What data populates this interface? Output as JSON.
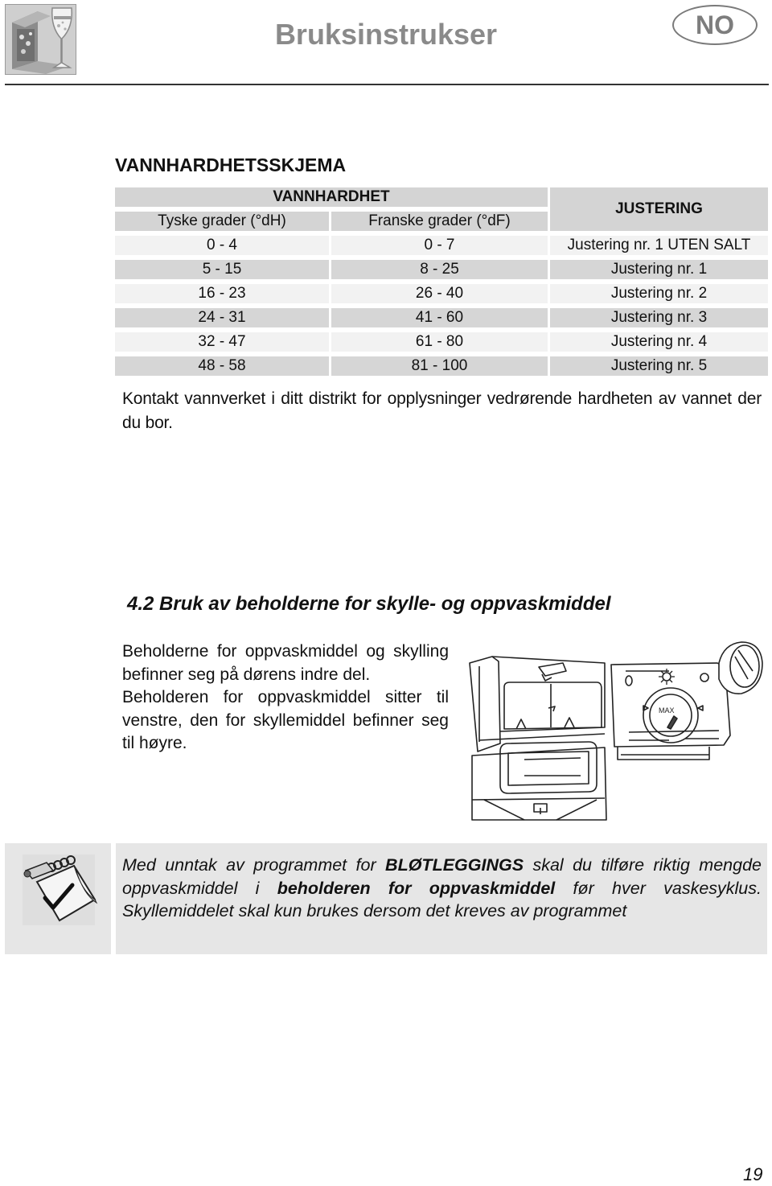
{
  "header": {
    "logo_icon": "dishwasher-wine-glass-logo",
    "title": "Bruksinstrukser",
    "language_badge": "NO"
  },
  "hardness_section": {
    "title": "VANNHARDHETSSKJEMA",
    "table": {
      "group_header": "VANNHARDHET",
      "columns": [
        "Tyske grader (°dH)",
        "Franske grader (°dF)",
        "JUSTERING"
      ],
      "rows": [
        {
          "dh": "0 - 4",
          "df": "0 - 7",
          "setting": "Justering nr. 1 UTEN SALT"
        },
        {
          "dh": "5 - 15",
          "df": "8 - 25",
          "setting": "Justering nr. 1"
        },
        {
          "dh": "16 - 23",
          "df": "26 - 40",
          "setting": "Justering nr. 2"
        },
        {
          "dh": "24 - 31",
          "df": "41 - 60",
          "setting": "Justering nr. 3"
        },
        {
          "dh": "32 - 47",
          "df": "61 - 80",
          "setting": "Justering nr. 4"
        },
        {
          "dh": "48 - 58",
          "df": "81 - 100",
          "setting": "Justering nr. 5"
        }
      ]
    },
    "note": "Kontakt vannverket i ditt distrikt for opplysninger vedrørende hardheten av vannet der du bor."
  },
  "dispenser_section": {
    "title": "4.2 Bruk av beholderne for skylle- og oppvaskmiddel",
    "paragraph1": "Beholderne for oppvaskmiddel og skylling befinner seg på dørens indre del.",
    "paragraph2": "Beholderen for oppvaskmiddel sitter til venstre, den for skyllemiddel befinner seg til høyre.",
    "illustration": "detergent-rinse-aid-dispenser-drawing",
    "dial_label": "MAX"
  },
  "tip_box": {
    "icon": "notepad-check-icon",
    "text_parts": [
      {
        "text": "Med unntak av programmet for ",
        "bold": false
      },
      {
        "text": "BLØTLEGGINGS",
        "bold": true
      },
      {
        "text": " skal du tilføre riktig mengde oppvaskmiddel i ",
        "bold": false
      },
      {
        "text": "beholderen for oppvaskmiddel",
        "bold": true
      },
      {
        "text": " før hver vaskesyklus. Skyllemiddelet skal kun brukes dersom det kreves av programmet",
        "bold": false
      }
    ]
  },
  "footer": {
    "page_number": "19"
  }
}
